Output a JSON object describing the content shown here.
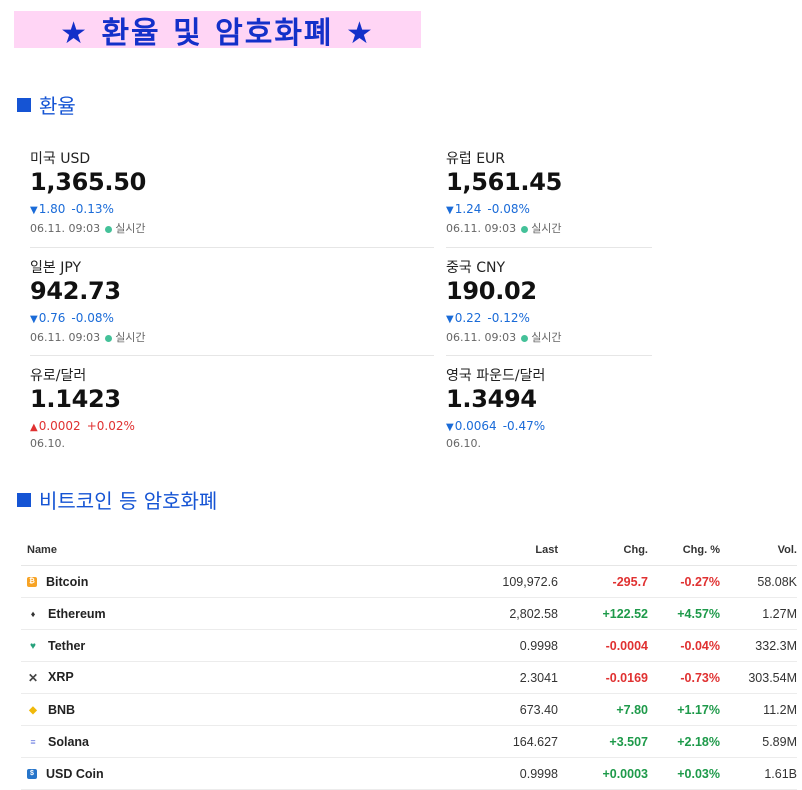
{
  "title": "★  환율  및  암호화폐 ★",
  "fx_section": {
    "heading": "환율"
  },
  "crypto_section": {
    "heading": "비트코인 등 암호화폐"
  },
  "fx": [
    {
      "name": "미국 USD",
      "value": "1,365.50",
      "direction": "down",
      "arrow": "▼",
      "change": "1.80",
      "pct": "-0.13%",
      "time": "06.11. 09:03",
      "live": "실시간"
    },
    {
      "name": "유럽 EUR",
      "value": "1,561.45",
      "direction": "down",
      "arrow": "▼",
      "change": "1.24",
      "pct": "-0.08%",
      "time": "06.11. 09:03",
      "live": "실시간"
    },
    {
      "name": "일본 JPY",
      "value": "942.73",
      "direction": "down",
      "arrow": "▼",
      "change": "0.76",
      "pct": "-0.08%",
      "time": "06.11. 09:03",
      "live": "실시간"
    },
    {
      "name": "중국 CNY",
      "value": "190.02",
      "direction": "down",
      "arrow": "▼",
      "change": "0.22",
      "pct": "-0.12%",
      "time": "06.11. 09:03",
      "live": "실시간"
    },
    {
      "name": "유로/달러",
      "value": "1.1423",
      "direction": "up",
      "arrow": "▲",
      "change": "0.0002",
      "pct": "+0.02%",
      "time": "06.10.",
      "live": ""
    },
    {
      "name": "영국 파운드/달러",
      "value": "1.3494",
      "direction": "down",
      "arrow": "▼",
      "change": "0.0064",
      "pct": "-0.47%",
      "time": "06.10.",
      "live": ""
    }
  ],
  "crypto_table": {
    "headers": {
      "name": "Name",
      "last": "Last",
      "chg": "Chg.",
      "chg_pct": "Chg. %",
      "vol": "Vol."
    },
    "rows": [
      {
        "icon": "bitcoin-icon",
        "glyph": "₿",
        "name": "Bitcoin",
        "last": "109,972.6",
        "chg": "-295.7",
        "chg_pct": "-0.27%",
        "vol": "58.08K",
        "trend": "neg"
      },
      {
        "icon": "ethereum-icon",
        "glyph": "♦",
        "name": "Ethereum",
        "last": "2,802.58",
        "chg": "+122.52",
        "chg_pct": "+4.57%",
        "vol": "1.27M",
        "trend": "pos"
      },
      {
        "icon": "tether-icon",
        "glyph": "♥",
        "name": "Tether",
        "last": "0.9998",
        "chg": "-0.0004",
        "chg_pct": "-0.04%",
        "vol": "332.3M",
        "trend": "neg"
      },
      {
        "icon": "xrp-icon",
        "glyph": "✕",
        "name": "XRP",
        "last": "2.3041",
        "chg": "-0.0169",
        "chg_pct": "-0.73%",
        "vol": "303.54M",
        "trend": "neg"
      },
      {
        "icon": "bnb-icon",
        "glyph": "◆",
        "name": "BNB",
        "last": "673.40",
        "chg": "+7.80",
        "chg_pct": "+1.17%",
        "vol": "11.2M",
        "trend": "pos"
      },
      {
        "icon": "solana-icon",
        "glyph": "≡",
        "name": "Solana",
        "last": "164.627",
        "chg": "+3.507",
        "chg_pct": "+2.18%",
        "vol": "5.89M",
        "trend": "pos"
      },
      {
        "icon": "usd-coin-icon",
        "glyph": "$",
        "name": "USD Coin",
        "last": "0.9998",
        "chg": "+0.0003",
        "chg_pct": "+0.03%",
        "vol": "1.61B",
        "trend": "pos"
      }
    ]
  },
  "colors": {
    "banner_bg": "#ffd5f5",
    "title": "#1330c9",
    "heading": "#1554d4",
    "down": "#1a6bd8",
    "up": "#e03131",
    "positive": "#1e9a4a",
    "live_dot": "#44c199"
  }
}
